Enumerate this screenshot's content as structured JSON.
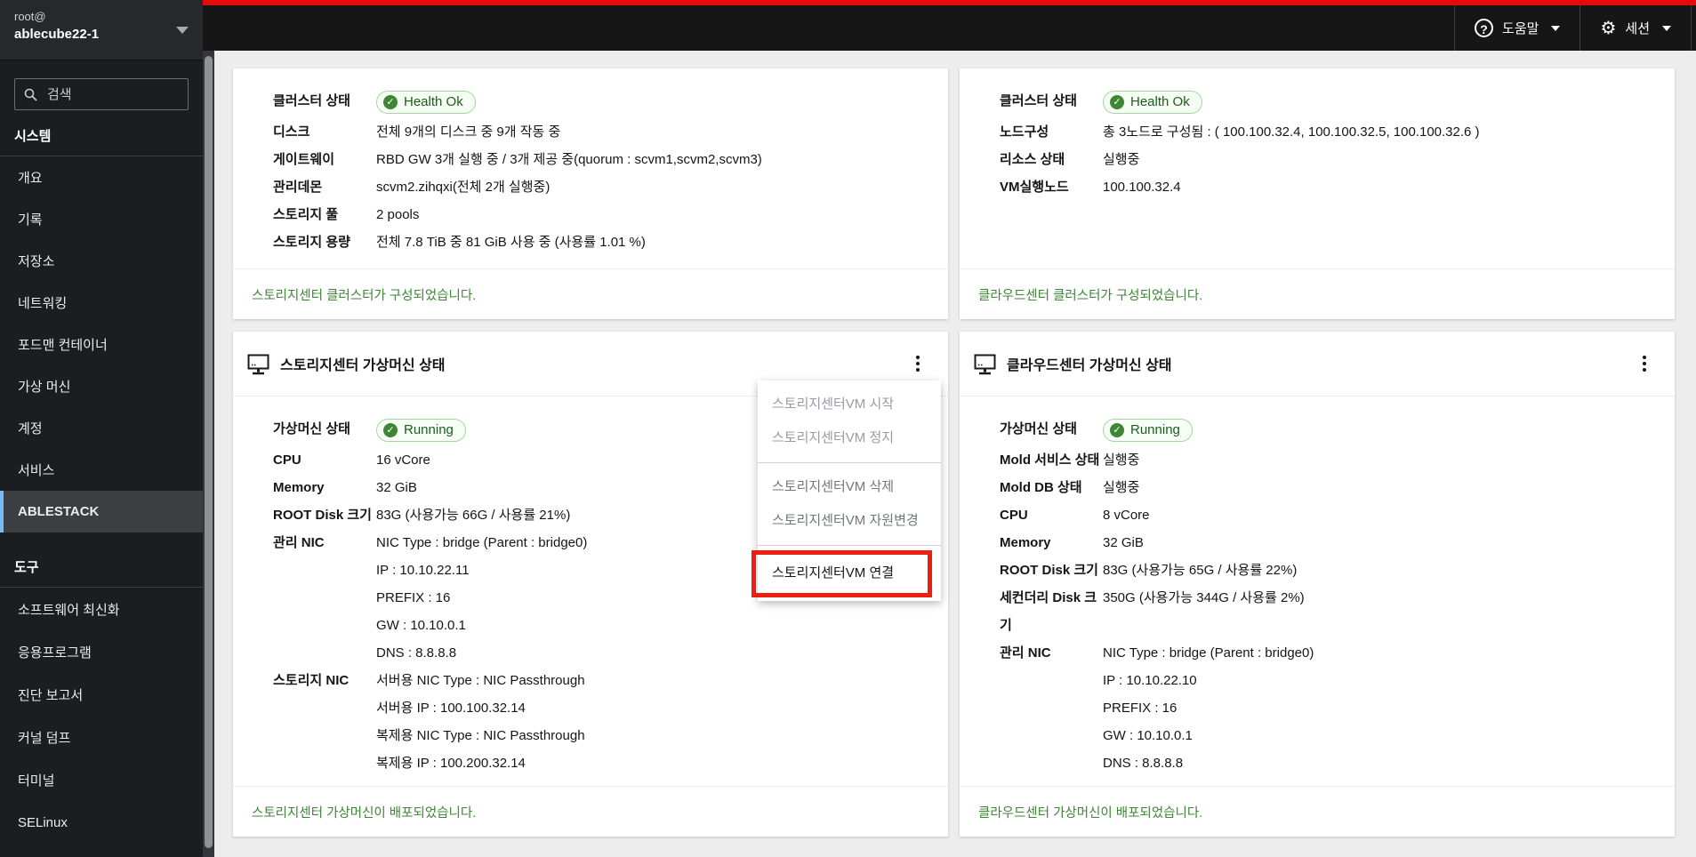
{
  "masthead": {
    "user_label": "root@",
    "hostname": "ablecube22-1",
    "help": {
      "label": "도움말",
      "icon_glyph": "?"
    },
    "session": {
      "label": "세션",
      "icon_glyph": "⚙"
    }
  },
  "sidebar": {
    "search_placeholder": "검색",
    "groups": [
      {
        "header": "시스템",
        "items": [
          {
            "label": "개요"
          },
          {
            "label": "기록"
          },
          {
            "label": "저장소"
          },
          {
            "label": "네트워킹"
          },
          {
            "label": "포드맨 컨테이너"
          },
          {
            "label": "가상 머신"
          },
          {
            "label": "계정"
          },
          {
            "label": "서비스"
          },
          {
            "label": "ABLESTACK",
            "selected": true
          }
        ]
      },
      {
        "header": "도구",
        "items": [
          {
            "label": "소프트웨어 최신화"
          },
          {
            "label": "응용프로그램"
          },
          {
            "label": "진단 보고서"
          },
          {
            "label": "커널 덤프"
          },
          {
            "label": "터미널"
          },
          {
            "label": "SELinux"
          }
        ]
      }
    ]
  },
  "cards": {
    "storage_cluster": {
      "rows": [
        {
          "label": "클러스터 상태",
          "badge": "Health Ok"
        },
        {
          "label": "디스크",
          "value": "전체 9개의 디스크 중 9개 작동 중"
        },
        {
          "label": "게이트웨이",
          "value": "RBD GW 3개 실행 중 / 3개 제공 중(quorum : scvm1,scvm2,scvm3)"
        },
        {
          "label": "관리데몬",
          "value": "scvm2.zihqxi(전체 2개 실행중)"
        },
        {
          "label": "스토리지 풀",
          "value": "2 pools"
        },
        {
          "label": "스토리지 용량",
          "value": "전체 7.8 TiB 중 81 GiB 사용 중 (사용률 1.01 %)"
        }
      ],
      "footer": "스토리지센터 클러스터가 구성되었습니다."
    },
    "cloud_cluster": {
      "rows": [
        {
          "label": "클러스터 상태",
          "badge": "Health Ok"
        },
        {
          "label": "노드구성",
          "value": "총 3노드로 구성됨 : ( 100.100.32.4, 100.100.32.5, 100.100.32.6 )"
        },
        {
          "label": "리소스 상태",
          "value": "실행중"
        },
        {
          "label": "VM실행노드",
          "value": "100.100.32.4"
        }
      ],
      "footer": "클라우드센터 클러스터가 구성되었습니다."
    },
    "storage_vm": {
      "title": "스토리지센터 가상머신 상태",
      "rows": [
        {
          "label": "가상머신 상태",
          "badge": "Running"
        },
        {
          "label": "CPU",
          "value": "16 vCore"
        },
        {
          "label": "Memory",
          "value": "32 GiB"
        },
        {
          "label": "ROOT Disk 크기",
          "value": "83G (사용가능 66G / 사용률 21%)"
        },
        {
          "label": "관리 NIC",
          "lines": [
            "NIC Type : bridge (Parent : bridge0)",
            "IP : 10.10.22.11",
            "PREFIX : 16",
            "GW : 10.10.0.1",
            "DNS : 8.8.8.8"
          ]
        },
        {
          "label": "스토리지 NIC",
          "lines": [
            "서버용 NIC Type : NIC Passthrough",
            "서버용 IP : 100.100.32.14",
            "복제용 NIC Type : NIC Passthrough",
            "복제용 IP : 100.200.32.14"
          ]
        }
      ],
      "footer": "스토리지센터 가상머신이 배포되었습니다.",
      "menu": {
        "items": [
          {
            "label": "스토리지센터VM 시작",
            "state": "disabled"
          },
          {
            "label": "스토리지센터VM 정지",
            "state": "disabled"
          },
          {
            "label": "스토리지센터VM 삭제",
            "state": "disabled"
          },
          {
            "label": "스토리지센터VM 자원변경",
            "state": "disabled"
          },
          {
            "label": "스토리지센터VM 연결",
            "state": "highlighted"
          }
        ]
      }
    },
    "cloud_vm": {
      "title": "클라우드센터 가상머신 상태",
      "rows": [
        {
          "label": "가상머신 상태",
          "badge": "Running"
        },
        {
          "label": "Mold 서비스 상태",
          "value": "실행중"
        },
        {
          "label": "Mold DB 상태",
          "value": "실행중"
        },
        {
          "label": "CPU",
          "value": "8 vCore"
        },
        {
          "label": "Memory",
          "value": "32 GiB"
        },
        {
          "label": "ROOT Disk 크기",
          "value": "83G (사용가능 65G / 사용률 22%)"
        },
        {
          "label": "세컨더리 Disk 크기",
          "value": "350G (사용가능 344G / 사용률 2%)"
        },
        {
          "label": "관리 NIC",
          "lines": [
            "NIC Type : bridge (Parent : bridge0)",
            "IP : 10.10.22.10",
            "PREFIX : 16",
            "GW : 10.10.0.1",
            "DNS : 8.8.8.8"
          ]
        }
      ],
      "footer": "클라우드센터 가상머신이 배포되었습니다."
    }
  },
  "icons": {
    "check": "✓",
    "kebab": "⋮",
    "search": "magnifier",
    "vm": "monitor"
  },
  "colors": {
    "masthead_red": "#e40b0b",
    "selected_blue": "#73bcf7",
    "footer_green": "#3e8635",
    "badge_green": "#3e8635",
    "annotation_red": "#ee1d11"
  }
}
